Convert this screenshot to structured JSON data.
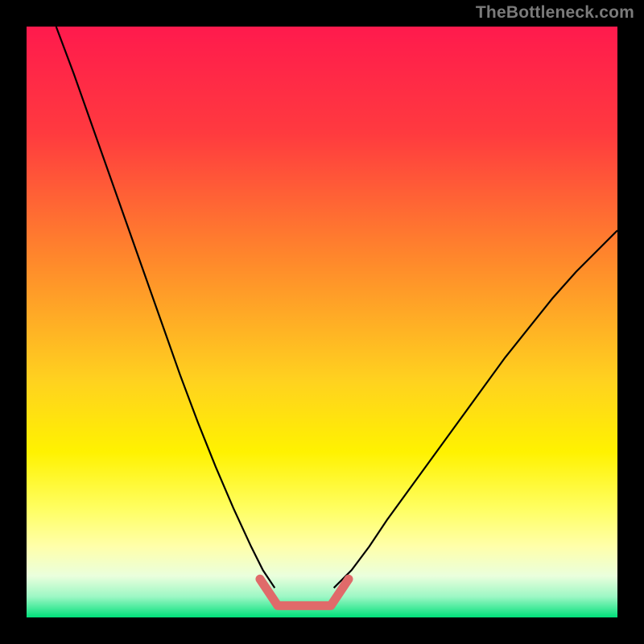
{
  "attribution": "TheBottleneck.com",
  "chart_data": {
    "type": "line",
    "title": "",
    "xlabel": "",
    "ylabel": "",
    "xlim": [
      0,
      100
    ],
    "ylim": [
      0,
      100
    ],
    "gradient_stops": [
      {
        "offset": 0,
        "color": "#ff1a4d"
      },
      {
        "offset": 0.18,
        "color": "#ff3a3f"
      },
      {
        "offset": 0.4,
        "color": "#ff8a2b"
      },
      {
        "offset": 0.6,
        "color": "#ffd21f"
      },
      {
        "offset": 0.72,
        "color": "#fff200"
      },
      {
        "offset": 0.82,
        "color": "#ffff66"
      },
      {
        "offset": 0.88,
        "color": "#ffffaa"
      },
      {
        "offset": 0.93,
        "color": "#eaffdd"
      },
      {
        "offset": 0.965,
        "color": "#9cf7c4"
      },
      {
        "offset": 1.0,
        "color": "#00e07a"
      }
    ],
    "series": [
      {
        "name": "left-curve",
        "stroke": "#000000",
        "stroke_width": 2.2,
        "x": [
          5,
          8,
          11,
          14,
          17,
          20,
          23,
          26,
          29,
          32,
          35,
          38,
          40,
          42
        ],
        "y": [
          100,
          92,
          83.5,
          75,
          66.5,
          58,
          49.5,
          41,
          33,
          25.5,
          18.5,
          12,
          8,
          5
        ]
      },
      {
        "name": "right-curve",
        "stroke": "#000000",
        "stroke_width": 2.2,
        "x": [
          52,
          55,
          58,
          61,
          65,
          69,
          73,
          77,
          81,
          85,
          89,
          93,
          97,
          100
        ],
        "y": [
          5,
          8,
          12,
          16.5,
          22,
          27.5,
          33,
          38.5,
          44,
          49,
          54,
          58.5,
          62.5,
          65.5
        ]
      },
      {
        "name": "bottom-notch",
        "stroke": "#e06a6a",
        "stroke_width": 11,
        "linecap": "round",
        "x": [
          39.5,
          42.5,
          51.5,
          54.5
        ],
        "y": [
          6.5,
          2.0,
          2.0,
          6.5
        ]
      }
    ]
  }
}
